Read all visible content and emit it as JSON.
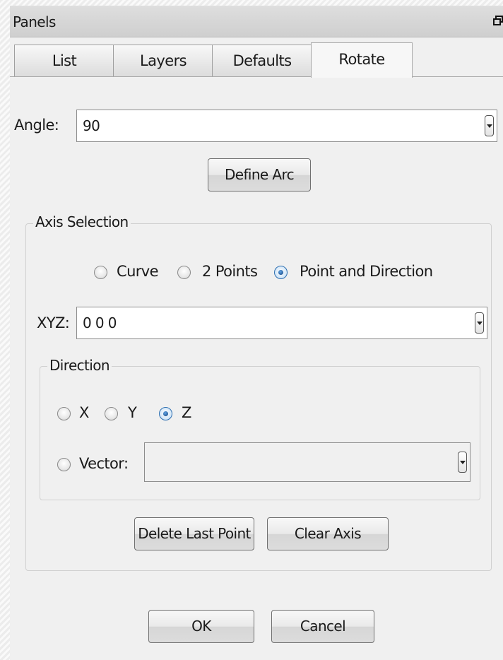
{
  "panel": {
    "title": "Panels"
  },
  "tabs": [
    {
      "label": "List",
      "active": false
    },
    {
      "label": "Layers",
      "active": false
    },
    {
      "label": "Defaults",
      "active": false
    },
    {
      "label": "Rotate",
      "active": true
    }
  ],
  "angle": {
    "label": "Angle:",
    "value": "90"
  },
  "define_arc_label": "Define Arc",
  "axis_selection": {
    "legend": "Axis Selection",
    "options": [
      {
        "label": "Curve",
        "checked": false
      },
      {
        "label": "2 Points",
        "checked": false
      },
      {
        "label": "Point and Direction",
        "checked": true
      }
    ],
    "xyz": {
      "label": "XYZ:",
      "value": "0 0 0"
    },
    "direction": {
      "legend": "Direction",
      "options": [
        {
          "label": "X",
          "checked": false
        },
        {
          "label": "Y",
          "checked": false
        },
        {
          "label": "Z",
          "checked": true
        }
      ],
      "vector": {
        "label": "Vector:",
        "checked": false,
        "value": ""
      }
    },
    "delete_last_point_label": "Delete Last Point",
    "clear_axis_label": "Clear Axis"
  },
  "footer": {
    "ok_label": "OK",
    "cancel_label": "Cancel"
  },
  "colors": {
    "background": "#f0f0f0",
    "titlebar": "#d6d6d6",
    "radio_selected": "#1a5aa0"
  },
  "icons": {
    "float": "float-window-icon",
    "dropdown": "chevron-down-icon"
  }
}
